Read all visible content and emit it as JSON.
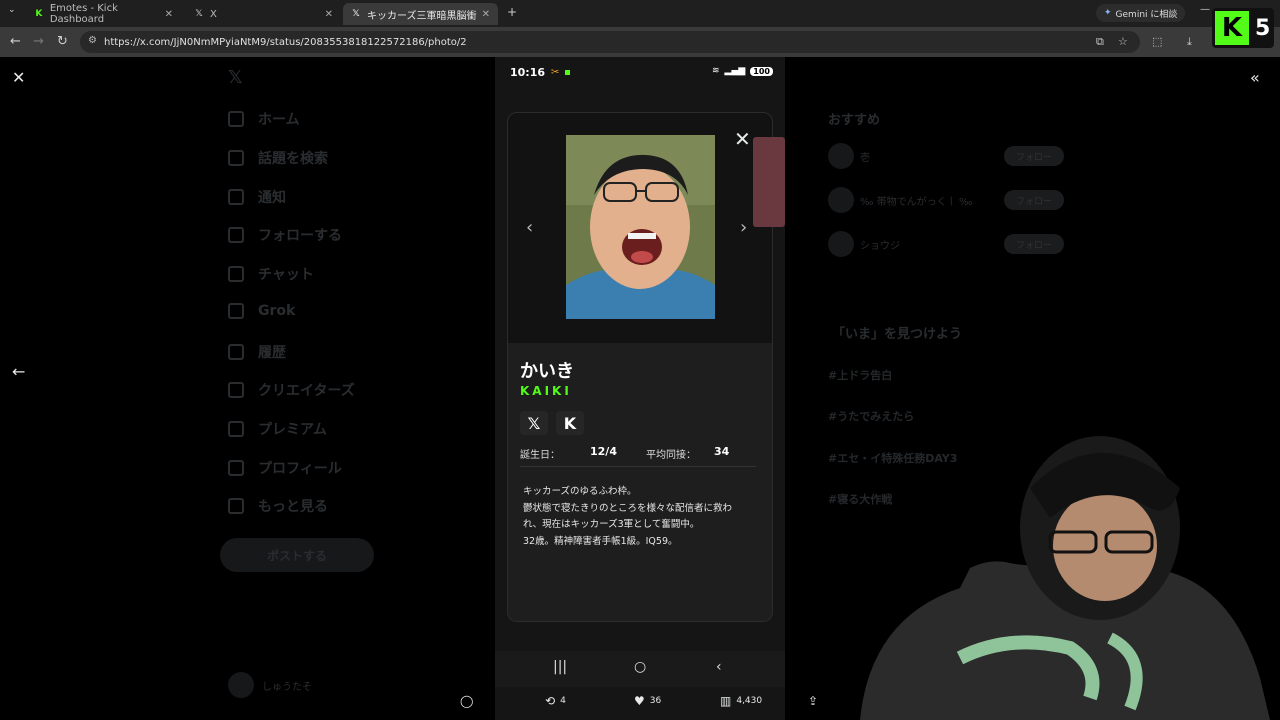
{
  "browser": {
    "tabs": [
      {
        "title": "Emotes - Kick Dashboard",
        "favicon": "kick-icon"
      },
      {
        "title": "X",
        "favicon": "x-icon"
      },
      {
        "title": "キッカーズ三軍暗黒脳衝国かいき",
        "favicon": "x-icon"
      }
    ],
    "new_tab": "+",
    "url": "https://x.com/JjN0NmMPyiaNtM9/status/2083553818122572186/photo/2",
    "gemini_label": "Gemini に相談"
  },
  "kick_badge": {
    "letter": "K",
    "count": "5"
  },
  "x_sidebar": {
    "items": [
      "ホーム",
      "話題を検索",
      "通知",
      "フォローする",
      "チャット",
      "Grok",
      "履歴",
      "クリエイターズ",
      "プレミアム",
      "プロフィール",
      "もっと見る"
    ],
    "post_button": "ポストする",
    "user": "しゅうたそ"
  },
  "x_right": {
    "recommend_heading": "おすすめ",
    "follow_label": "フォロー",
    "accounts": [
      "壱",
      "‰ 帯物でんがっくￜ ‰",
      "ショウジ"
    ],
    "trends_heading": "「いま」を見つけよう",
    "trends": [
      "#上ドラ告白",
      "#うたでみえたら",
      "#エセ・イ特殊任務DAY3",
      "#寝る大作戦"
    ]
  },
  "phone": {
    "time": "10:16",
    "battery": "100"
  },
  "card": {
    "name_jp": "かいき",
    "name_en": "KAIKI",
    "birthday_label": "誕生日：",
    "birthday_value": "12/4",
    "avg_viewers_label": "平均同接：",
    "avg_viewers_value": "34",
    "bio_lines": [
      "キッカーズのゆるふわ枠。",
      "鬱状態で寝たきりのところを様々な配信者に救わ",
      "れ、現在はキッカーズ3軍として奮闘中。",
      "32歳。精神障害者手帳1級。IQ59。"
    ],
    "social": [
      "x-icon",
      "kick-icon"
    ]
  },
  "actions": {
    "reply_count": "",
    "repost_count": "4",
    "like_count": "36",
    "views_count": "4,430"
  },
  "colors": {
    "kick_green": "#53fc18",
    "background": "#000000",
    "card": "#1e1e1e"
  }
}
